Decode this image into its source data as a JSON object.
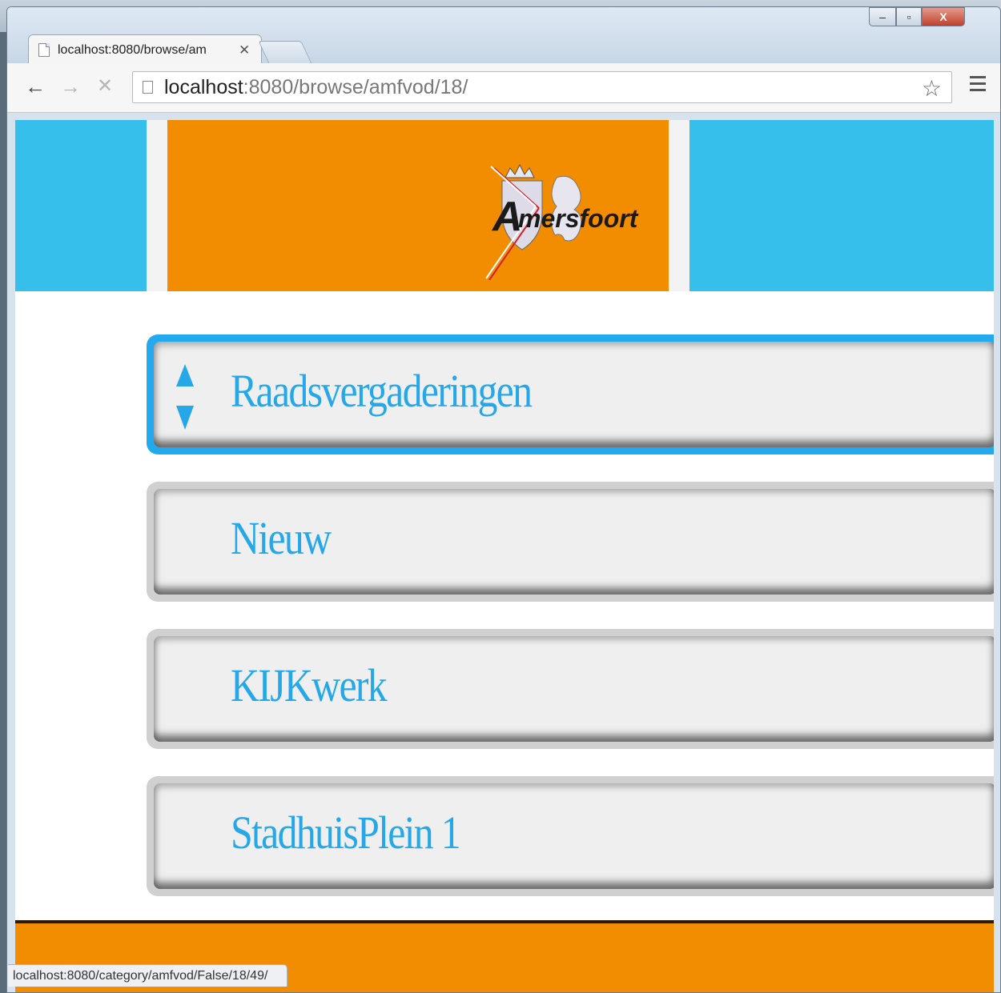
{
  "browser": {
    "tab_title": "localhost:8080/browse/am",
    "tab_close": "✕",
    "url_host": "localhost",
    "url_rest": ":8080/browse/amfvod/18/",
    "status_url": "localhost:8080/category/amfvod/False/18/49/",
    "window_controls": {
      "minimize": "–",
      "maximize": "▫",
      "close": "X"
    },
    "icons": {
      "back": "back-arrow-icon",
      "forward": "forward-arrow-icon",
      "stop": "stop-icon",
      "bookmark": "star-icon",
      "menu": "hamburger-menu-icon"
    }
  },
  "header": {
    "logo_text": "mersfoort",
    "logo_initial": "A",
    "colors": {
      "cyan": "#37bfec",
      "orange": "#f28c00"
    }
  },
  "menu": {
    "items": [
      {
        "label": "Raadsvergaderingen",
        "selected": true
      },
      {
        "label": "Nieuw",
        "selected": false
      },
      {
        "label": "KIJKwerk",
        "selected": false
      },
      {
        "label": "StadhuisPlein 1",
        "selected": false
      }
    ],
    "colors": {
      "label": "#26a8e8",
      "selected_border": "#22a9ee"
    }
  }
}
